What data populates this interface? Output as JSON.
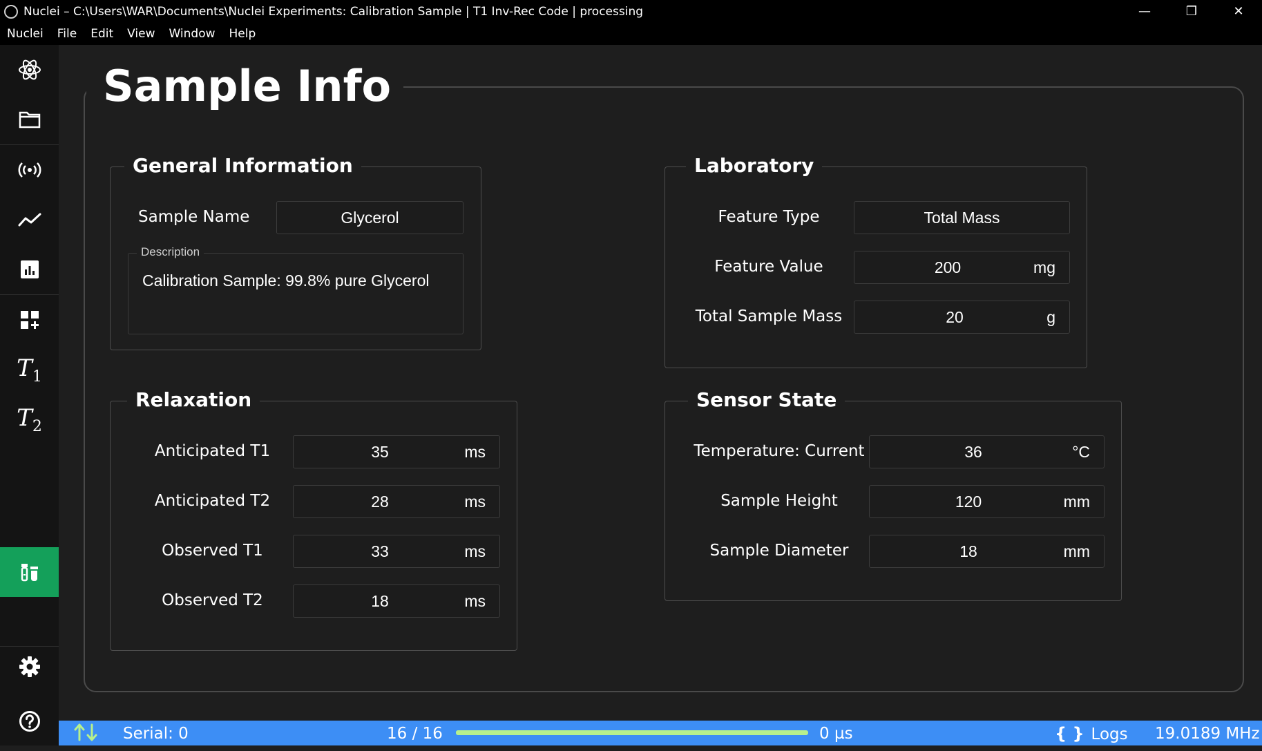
{
  "window": {
    "title": "Nuclei – C:\\Users\\WAR\\Documents\\Nuclei Experiments: Calibration Sample | T1 Inv-Rec Code | processing",
    "controls": [
      "—",
      "❐",
      "✕"
    ]
  },
  "menu": [
    "Nuclei",
    "File",
    "Edit",
    "View",
    "Window",
    "Help"
  ],
  "sidebar": {
    "items": [
      {
        "icon": "atom-logo-icon"
      },
      {
        "icon": "folder-icon"
      },
      {
        "icon": "broadcast-icon"
      },
      {
        "icon": "line-chart-icon"
      },
      {
        "icon": "bar-chart-icon"
      },
      {
        "icon": "dashboard-add-icon"
      },
      {
        "icon": "t1-icon",
        "label": "T",
        "sub": "1"
      },
      {
        "icon": "t2-icon",
        "label": "T",
        "sub": "2"
      },
      {
        "icon": "sample-prep-icon"
      },
      {
        "icon": "sample-info-icon",
        "active": true
      },
      {
        "icon": "gear-icon"
      },
      {
        "icon": "cart-icon"
      },
      {
        "icon": "help-icon"
      }
    ],
    "active_color": "#14a05a"
  },
  "page": {
    "title": "Sample Info",
    "general": {
      "title": "General Information",
      "sample_name_label": "Sample Name",
      "sample_name_value": "Glycerol",
      "description_label": "Description",
      "description_value": "Calibration Sample: 99.8% pure Glycerol"
    },
    "laboratory": {
      "title": "Laboratory",
      "rows": [
        {
          "label": "Feature Type",
          "value": "Total Mass",
          "unit": ""
        },
        {
          "label": "Feature Value",
          "value": "200",
          "unit": "mg"
        },
        {
          "label": "Total Sample Mass",
          "value": "20",
          "unit": "g"
        }
      ]
    },
    "relaxation": {
      "title": "Relaxation",
      "rows": [
        {
          "label": "Anticipated T1",
          "value": "35",
          "unit": "ms"
        },
        {
          "label": "Anticipated T2",
          "value": "28",
          "unit": "ms"
        },
        {
          "label": "Observed T1",
          "value": "33",
          "unit": "ms"
        },
        {
          "label": "Observed T2",
          "value": "18",
          "unit": "ms"
        }
      ]
    },
    "sensor": {
      "title": "Sensor State",
      "rows": [
        {
          "label": "Temperature: Current",
          "value": "36",
          "unit": "°C"
        },
        {
          "label": "Sample Height",
          "value": "120",
          "unit": "mm"
        },
        {
          "label": "Sample Diameter",
          "value": "18",
          "unit": "mm"
        }
      ]
    }
  },
  "status": {
    "serial": "Serial: 0",
    "progress_text": "16 / 16",
    "progress_fraction": 1.0,
    "time": "0 µs",
    "logs": "Logs",
    "frequency": "19.0189 MHz",
    "bar_color": "#3d8ef5",
    "progress_color": "#b7f08d"
  }
}
